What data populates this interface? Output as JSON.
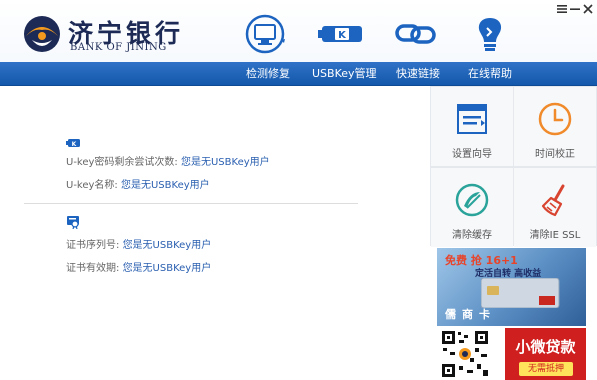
{
  "window": {
    "menu_icon": "hamburger-menu-icon",
    "minimize_icon": "minimize-icon",
    "close_icon": "close-icon"
  },
  "brand": {
    "name_cn": "济宁银行",
    "name_en": "BANK OF JINING",
    "colors": {
      "navy": "#1c2a55",
      "orange": "#f39a1e",
      "blue": "#1458ab"
    }
  },
  "top_icons": [
    {
      "name": "monitor-repair-icon"
    },
    {
      "name": "usbkey-icon",
      "text": "K"
    },
    {
      "name": "link-icon"
    },
    {
      "name": "lightbulb-help-icon"
    }
  ],
  "nav": {
    "items": [
      "检测修复",
      "USBKey管理",
      "快速链接",
      "在线帮助"
    ]
  },
  "usbkey_section": {
    "icon": "usbkey-small-icon",
    "icon_text": "K",
    "retries_label": "U-key密码剩余尝试次数: ",
    "retries_value": "您是无USBKey用户",
    "name_label": "U-key名称: ",
    "name_value": "您是无USBKey用户"
  },
  "cert_section": {
    "icon": "certificate-icon",
    "serial_label": "证书序列号: ",
    "serial_value": "您是无USBKey用户",
    "validity_label": "证书有效期: ",
    "validity_value": "您是无USBKey用户"
  },
  "tools": [
    {
      "label": "设置向导",
      "icon": "setup-wizard-icon"
    },
    {
      "label": "时间校正",
      "icon": "clock-icon"
    },
    {
      "label": "清除缓存",
      "icon": "clear-cache-icon"
    },
    {
      "label": "清除IE SSL",
      "icon": "broom-icon"
    }
  ],
  "ads": {
    "promo_line": "免费 抢 16+1",
    "promo_sub": "定活自转 高收益",
    "card_footer": "儒商卡",
    "loan_title": "小微贷款",
    "loan_sub": "无需抵押",
    "qr_icon": "qr-code-icon"
  }
}
